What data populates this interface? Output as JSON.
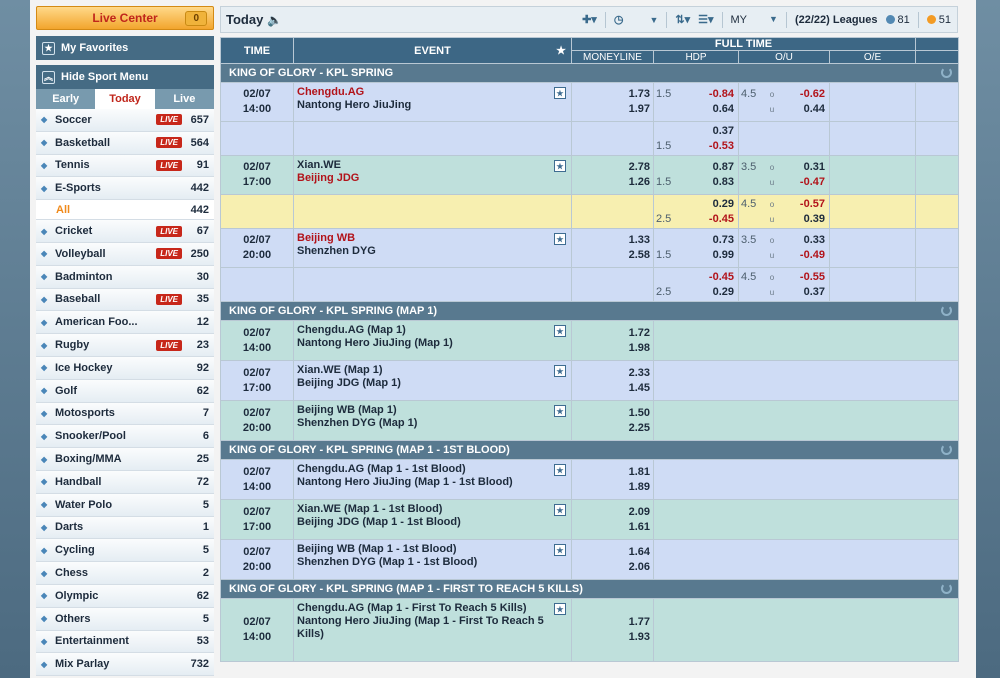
{
  "sidebar": {
    "live_center": "Live Center",
    "live_count": "0",
    "favorites": "My Favorites",
    "hide_menu": "Hide Sport Menu",
    "tabs": [
      "Early",
      "Today",
      "Live"
    ],
    "sports": [
      {
        "name": "Soccer",
        "live": true,
        "count": "657"
      },
      {
        "name": "Basketball",
        "live": true,
        "count": "564"
      },
      {
        "name": "Tennis",
        "live": true,
        "count": "91"
      },
      {
        "name": "E-Sports",
        "live": false,
        "count": "442"
      },
      {
        "name": "Cricket",
        "live": true,
        "count": "67"
      },
      {
        "name": "Volleyball",
        "live": true,
        "count": "250"
      },
      {
        "name": "Badminton",
        "live": false,
        "count": "30"
      },
      {
        "name": "Baseball",
        "live": true,
        "count": "35"
      },
      {
        "name": "American Foo...",
        "live": false,
        "count": "12"
      },
      {
        "name": "Rugby",
        "live": true,
        "count": "23"
      },
      {
        "name": "Ice Hockey",
        "live": false,
        "count": "92"
      },
      {
        "name": "Golf",
        "live": false,
        "count": "62"
      },
      {
        "name": "Motosports",
        "live": false,
        "count": "7"
      },
      {
        "name": "Snooker/Pool",
        "live": false,
        "count": "6"
      },
      {
        "name": "Boxing/MMA",
        "live": false,
        "count": "25"
      },
      {
        "name": "Handball",
        "live": false,
        "count": "72"
      },
      {
        "name": "Water Polo",
        "live": false,
        "count": "5"
      },
      {
        "name": "Darts",
        "live": false,
        "count": "1"
      },
      {
        "name": "Cycling",
        "live": false,
        "count": "5"
      },
      {
        "name": "Chess",
        "live": false,
        "count": "2"
      },
      {
        "name": "Olympic",
        "live": false,
        "count": "62"
      },
      {
        "name": "Others",
        "live": false,
        "count": "5"
      },
      {
        "name": "Entertainment",
        "live": false,
        "count": "53"
      },
      {
        "name": "Mix Parlay",
        "live": false,
        "count": "732"
      }
    ],
    "live_badge": "LIVE",
    "sub_all": {
      "name": "All",
      "count": "442"
    }
  },
  "topbar": {
    "title": "Today",
    "odds_type": "MY",
    "leagues_count": "(22/22)",
    "leagues_label": "Leagues",
    "coin1": "81",
    "coin2": "51"
  },
  "header": {
    "time": "TIME",
    "event": "EVENT",
    "full_time": "FULL TIME",
    "moneyline": "MONEYLINE",
    "hdp": "HDP",
    "ou": "O/U",
    "oe": "O/E"
  },
  "leagues": [
    {
      "name": "KING OF GLORY - KPL SPRING"
    },
    {
      "name": "KING OF GLORY - KPL SPRING (MAP 1)"
    },
    {
      "name": "KING OF GLORY - KPL SPRING (MAP 1 - 1ST BLOOD)"
    },
    {
      "name": "KING OF GLORY - KPL SPRING (MAP 1 - FIRST TO REACH 5 KILLS)"
    }
  ],
  "matches": [
    {
      "date": "02/07",
      "time": "14:00",
      "home": "Chengdu.AG",
      "away": "Nantong Hero JiuJing",
      "ml_home": "1.73",
      "ml_away": "1.97",
      "hdp_line": "1.5",
      "hdp_home": "-0.84",
      "hdp_away": "0.64",
      "ou_line": "4.5",
      "ou_o": "-0.62",
      "ou_u": "0.44"
    },
    {
      "date": "02/07",
      "time": "17:00",
      "home": "Xian.WE",
      "away": "Beijing JDG",
      "ml_home": "2.78",
      "ml_away": "1.26",
      "hdp_line": "1.5",
      "hdp_home": "0.87",
      "hdp_away": "0.83",
      "ou_line": "3.5",
      "ou_o": "0.31",
      "ou_u": "-0.47"
    },
    {
      "date": "02/07",
      "time": "20:00",
      "home": "Beijing WB",
      "away": "Shenzhen DYG",
      "ml_home": "1.33",
      "ml_away": "2.58",
      "hdp_line": "1.5",
      "hdp_home": "0.73",
      "hdp_away": "0.99",
      "ou_line": "3.5",
      "ou_o": "0.33",
      "ou_u": "-0.49"
    }
  ],
  "extra_lines": [
    {
      "hdp_line": "1.5",
      "hdp_home": "0.37",
      "hdp_away": "-0.53"
    },
    {
      "hdp_line": "2.5",
      "hdp_home": "0.29",
      "hdp_away": "-0.45",
      "ou_line": "4.5",
      "ou_o": "-0.57",
      "ou_u": "0.39"
    },
    {
      "hdp_line": "2.5",
      "hdp_home": "-0.45",
      "hdp_away": "0.29",
      "ou_line": "4.5",
      "ou_o": "-0.55",
      "ou_u": "0.37"
    }
  ],
  "map1": [
    {
      "date": "02/07",
      "time": "14:00",
      "home": "Chengdu.AG (Map 1)",
      "away": "Nantong Hero JiuJing (Map 1)",
      "ml_home": "1.72",
      "ml_away": "1.98"
    },
    {
      "date": "02/07",
      "time": "17:00",
      "home": "Xian.WE (Map 1)",
      "away": "Beijing JDG (Map 1)",
      "ml_home": "2.33",
      "ml_away": "1.45"
    },
    {
      "date": "02/07",
      "time": "20:00",
      "home": "Beijing WB (Map 1)",
      "away": "Shenzhen DYG (Map 1)",
      "ml_home": "1.50",
      "ml_away": "2.25"
    }
  ],
  "blood": [
    {
      "date": "02/07",
      "time": "14:00",
      "home": "Chengdu.AG (Map 1 - 1st Blood)",
      "away": "Nantong Hero JiuJing (Map 1 - 1st Blood)",
      "ml_home": "1.81",
      "ml_away": "1.89"
    },
    {
      "date": "02/07",
      "time": "17:00",
      "home": "Xian.WE (Map 1 - 1st Blood)",
      "away": "Beijing JDG (Map 1 - 1st Blood)",
      "ml_home": "2.09",
      "ml_away": "1.61"
    },
    {
      "date": "02/07",
      "time": "20:00",
      "home": "Beijing WB (Map 1 - 1st Blood)",
      "away": "Shenzhen DYG (Map 1 - 1st Blood)",
      "ml_home": "1.64",
      "ml_away": "2.06"
    }
  ],
  "kills": [
    {
      "date": "02/07",
      "time": "14:00",
      "home": "Chengdu.AG (Map 1 - First To Reach 5 Kills)",
      "away": "Nantong Hero JiuJing (Map 1 - First To Reach 5 Kills)",
      "ml_home": "1.77",
      "ml_away": "1.93"
    }
  ],
  "ou_over": "o",
  "ou_under": "u"
}
